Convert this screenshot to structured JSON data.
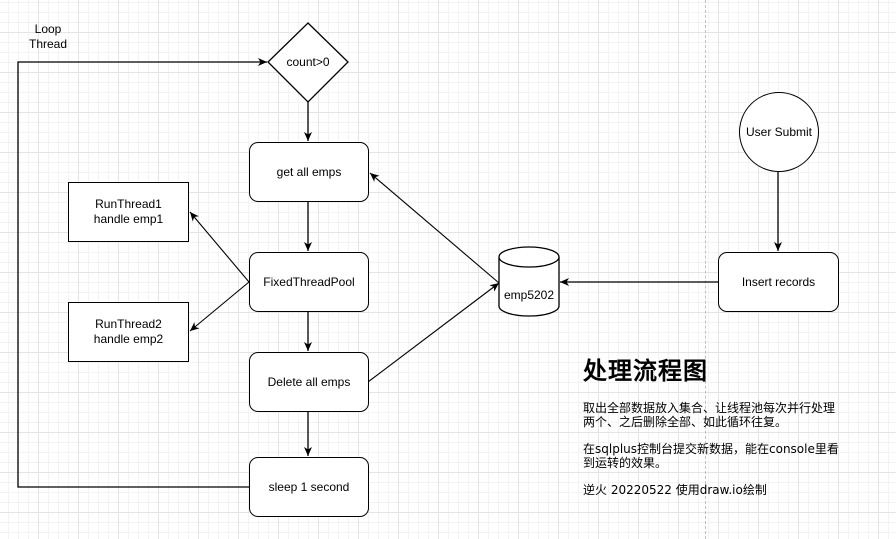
{
  "diagram": {
    "title_label": "Loop\nThread",
    "nodes": {
      "decision": "count>0",
      "get_all": "get all emps",
      "pool": "FixedThreadPool",
      "delete_all": "Delete all emps",
      "sleep": "sleep 1 second",
      "run1": "RunThread1\nhandle emp1",
      "run2": "RunThread2\nhandle emp2",
      "db": "emp5202",
      "insert": "Insert records",
      "user": "User Submit"
    },
    "edges": [
      {
        "from": "decision",
        "to": "get_all"
      },
      {
        "from": "get_all",
        "to": "pool"
      },
      {
        "from": "pool",
        "to": "run1"
      },
      {
        "from": "pool",
        "to": "run2"
      },
      {
        "from": "pool",
        "to": "delete_all"
      },
      {
        "from": "delete_all",
        "to": "sleep"
      },
      {
        "from": "delete_all",
        "to": "db"
      },
      {
        "from": "db",
        "to": "get_all"
      },
      {
        "from": "insert",
        "to": "db"
      },
      {
        "from": "user",
        "to": "insert"
      },
      {
        "from": "sleep",
        "to": "decision",
        "label": "Loop Thread"
      }
    ]
  },
  "notes": {
    "heading": "处理流程图",
    "paragraph1": "取出全部数据放入集合、让线程池每次并行处理两个、之后删除全部、如此循环往复。",
    "paragraph2": "在sqlplus控制台提交新数据，能在console里看到运转的效果。",
    "paragraph3": "逆火  20220522 使用draw.io绘制"
  }
}
